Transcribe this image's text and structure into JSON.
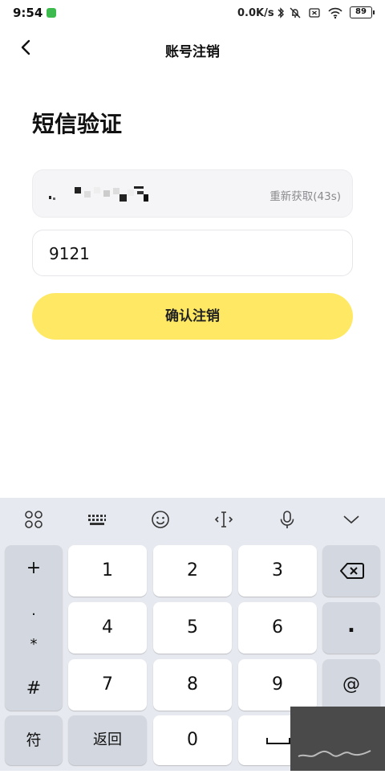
{
  "status_bar": {
    "time": "9:54",
    "net_speed": "0.0K/s",
    "battery": "89"
  },
  "nav": {
    "title": "账号注销"
  },
  "page": {
    "heading": "短信验证"
  },
  "phone": {
    "resend_label": "重新获取(43s)"
  },
  "code": {
    "value": "9121"
  },
  "confirm": {
    "label": "确认注销"
  },
  "keyboard": {
    "left_col": [
      "+",
      ".",
      "*",
      "#",
      "符"
    ],
    "keys": [
      "1",
      "2",
      "3",
      "4",
      "5",
      "6",
      "7",
      "8",
      "9",
      "0"
    ],
    "back_label": "返回",
    "dot": ".",
    "at": "@",
    "toolbar_icons": [
      "grid-apps-icon",
      "keyboard-icon",
      "emoji-icon",
      "cursor-move-icon",
      "microphone-icon",
      "chevron-down-icon"
    ]
  },
  "colors": {
    "accent": "#ffe964",
    "keyboard_bg": "#e6e9ef"
  }
}
